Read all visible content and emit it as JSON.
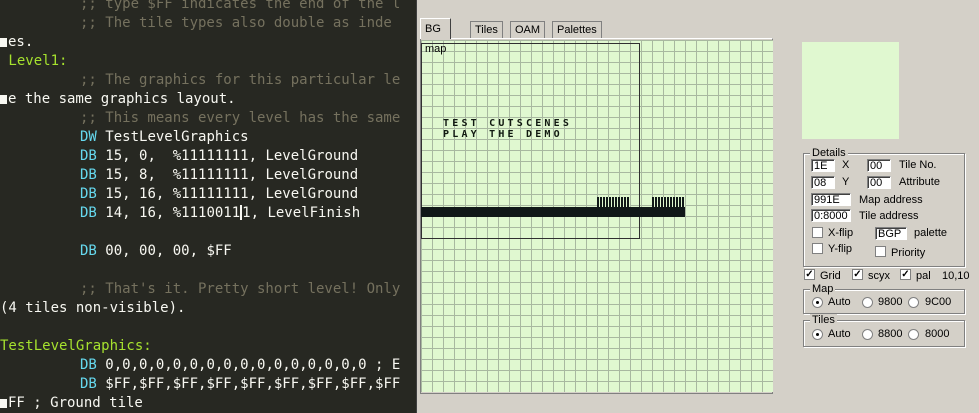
{
  "editor": {
    "lines": [
      {
        "indent": true,
        "parts": [
          {
            "cls": "c-comment",
            "t": ";; type $FF indicates the end of the l"
          }
        ]
      },
      {
        "indent": true,
        "parts": [
          {
            "cls": "c-comment",
            "t": ";; The tile types also double as inde"
          }
        ]
      },
      {
        "indent": false,
        "wrap": true,
        "parts": [
          {
            "cls": "",
            "t": "es."
          }
        ]
      },
      {
        "indent": false,
        "parts": [
          {
            "cls": "c-label",
            "t": " Level1:"
          }
        ]
      },
      {
        "indent": true,
        "parts": [
          {
            "cls": "c-comment",
            "t": ";; The graphics for this particular le"
          }
        ]
      },
      {
        "indent": false,
        "wrap": true,
        "parts": [
          {
            "cls": "",
            "t": "e the same graphics layout."
          }
        ]
      },
      {
        "indent": true,
        "parts": [
          {
            "cls": "c-comment",
            "t": ";; This means every level has the same"
          }
        ]
      },
      {
        "indent": true,
        "parts": [
          {
            "cls": "c-kw",
            "t": "DW "
          },
          {
            "cls": "",
            "t": "TestLevelGraphics"
          }
        ]
      },
      {
        "indent": true,
        "parts": [
          {
            "cls": "c-kw",
            "t": "DB "
          },
          {
            "cls": "",
            "t": "15, 0,  %11111111, LevelGround"
          }
        ]
      },
      {
        "indent": true,
        "parts": [
          {
            "cls": "c-kw",
            "t": "DB "
          },
          {
            "cls": "",
            "t": "15, 8,  %11111111, LevelGround"
          }
        ]
      },
      {
        "indent": true,
        "parts": [
          {
            "cls": "c-kw",
            "t": "DB "
          },
          {
            "cls": "",
            "t": "15, 16, %11111111, LevelGround"
          }
        ]
      },
      {
        "indent": true,
        "cursor": true,
        "parts": [
          {
            "cls": "c-kw",
            "t": "DB "
          },
          {
            "cls": "",
            "t": "14, 16, %1110011"
          },
          {
            "cls": "cur",
            "t": ""
          },
          {
            "cls": "",
            "t": "1, LevelFinish"
          }
        ]
      },
      {
        "indent": false,
        "parts": []
      },
      {
        "indent": true,
        "parts": [
          {
            "cls": "c-kw",
            "t": "DB "
          },
          {
            "cls": "",
            "t": "00, 00, 00, $FF"
          }
        ]
      },
      {
        "indent": false,
        "parts": []
      },
      {
        "indent": true,
        "parts": [
          {
            "cls": "c-comment",
            "t": ";; That's it. Pretty short level! Only"
          }
        ]
      },
      {
        "indent": false,
        "parts": [
          {
            "cls": "",
            "t": "(4 tiles non-visible)."
          }
        ]
      },
      {
        "indent": false,
        "parts": []
      },
      {
        "indent": false,
        "parts": [
          {
            "cls": "c-label",
            "t": "TestLevelGraphics:"
          }
        ]
      },
      {
        "indent": true,
        "parts": [
          {
            "cls": "c-kw",
            "t": "DB "
          },
          {
            "cls": "",
            "t": "0,0,0,0,0,0,0,0,0,0,0,0,0,0,0,0 ; E"
          }
        ]
      },
      {
        "indent": true,
        "parts": [
          {
            "cls": "c-kw",
            "t": "DB "
          },
          {
            "cls": "",
            "t": "$FF,$FF,$FF,$FF,$FF,$FF,$FF,$FF,$FF"
          }
        ]
      },
      {
        "indent": false,
        "wrap": true,
        "parts": [
          {
            "cls": "",
            "t": "FF ; Ground tile"
          }
        ]
      }
    ]
  },
  "debugger": {
    "tabs": [
      "BG map",
      "Tiles",
      "OAM",
      "Palettes"
    ],
    "active_tab": "BG map",
    "map_text": [
      "TEST CUTSCENES",
      "PLAY THE DEMO"
    ],
    "details": {
      "title": "Details",
      "x_value": "1E",
      "x_label": "X",
      "y_value": "08",
      "y_label": "Y",
      "tile_no_value": "00",
      "tile_no_label": "Tile No.",
      "attribute_value": "00",
      "attribute_label": "Attribute",
      "map_address_value": "991E",
      "map_address_label": "Map address",
      "tile_address_value": "0:8000",
      "tile_address_label": "Tile address",
      "xflip_label": "X-flip",
      "yflip_label": "Y-flip",
      "palette_value": "BGP",
      "palette_label": "palette",
      "priority_label": "Priority"
    },
    "options": {
      "grid_label": "Grid",
      "scyx_label": "scyx",
      "pal_label": "pal",
      "coords": "10,10"
    },
    "map_group": {
      "title": "Map",
      "options": [
        "Auto",
        "9800",
        "9C00"
      ],
      "selected": "Auto"
    },
    "tiles_group": {
      "title": "Tiles",
      "options": [
        "Auto",
        "8800",
        "8000"
      ],
      "selected": "Auto"
    },
    "colors": {
      "lcd_bg": "#e0f8d0",
      "lcd_dark": "#101818",
      "editor_bg": "#272822",
      "window_bg": "#d4d0c8"
    }
  }
}
